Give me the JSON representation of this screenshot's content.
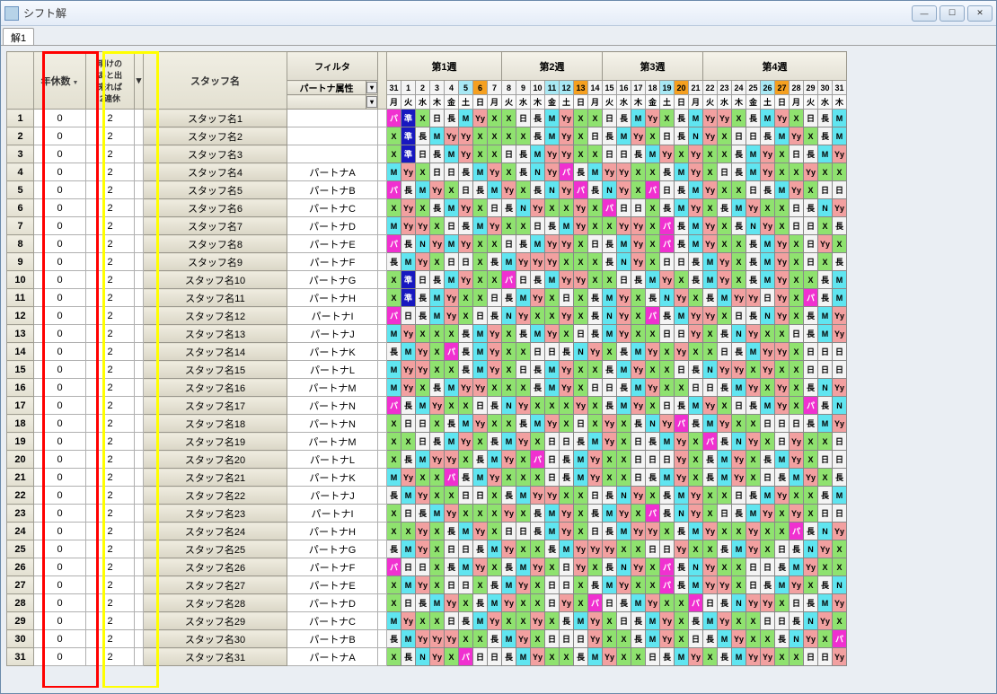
{
  "window": {
    "title": "シフト解"
  },
  "tabs": [
    "解1"
  ],
  "headers": {
    "nenkyu": "年休数",
    "ake": "明けの\nあと出\n来れば\n2連休",
    "staff": "スタッフ名",
    "filter": "フィルタ",
    "partner": "パートナ属性",
    "weeks": [
      "第1週",
      "第2週",
      "第3週",
      "第4週"
    ]
  },
  "days": [
    {
      "n": 31,
      "dow": "月",
      "cls": ""
    },
    {
      "n": 1,
      "dow": "火",
      "cls": ""
    },
    {
      "n": 2,
      "dow": "水",
      "cls": ""
    },
    {
      "n": 3,
      "dow": "木",
      "cls": ""
    },
    {
      "n": 4,
      "dow": "金",
      "cls": ""
    },
    {
      "n": 5,
      "dow": "土",
      "cls": "cy"
    },
    {
      "n": 6,
      "dow": "日",
      "cls": "or"
    },
    {
      "n": 7,
      "dow": "月",
      "cls": ""
    },
    {
      "n": 8,
      "dow": "火",
      "cls": ""
    },
    {
      "n": 9,
      "dow": "水",
      "cls": ""
    },
    {
      "n": 10,
      "dow": "木",
      "cls": ""
    },
    {
      "n": 11,
      "dow": "金",
      "cls": "cy"
    },
    {
      "n": 12,
      "dow": "土",
      "cls": "cy"
    },
    {
      "n": 13,
      "dow": "日",
      "cls": "or"
    },
    {
      "n": 14,
      "dow": "月",
      "cls": ""
    },
    {
      "n": 15,
      "dow": "火",
      "cls": ""
    },
    {
      "n": 16,
      "dow": "水",
      "cls": ""
    },
    {
      "n": 17,
      "dow": "木",
      "cls": ""
    },
    {
      "n": 18,
      "dow": "金",
      "cls": ""
    },
    {
      "n": 19,
      "dow": "土",
      "cls": "cy"
    },
    {
      "n": 20,
      "dow": "日",
      "cls": "or"
    },
    {
      "n": 21,
      "dow": "月",
      "cls": ""
    },
    {
      "n": 22,
      "dow": "火",
      "cls": ""
    },
    {
      "n": 23,
      "dow": "水",
      "cls": ""
    },
    {
      "n": 24,
      "dow": "木",
      "cls": ""
    },
    {
      "n": 25,
      "dow": "金",
      "cls": ""
    },
    {
      "n": 26,
      "dow": "土",
      "cls": "cy"
    },
    {
      "n": 27,
      "dow": "日",
      "cls": "or"
    },
    {
      "n": 28,
      "dow": "月",
      "cls": ""
    },
    {
      "n": 29,
      "dow": "火",
      "cls": ""
    },
    {
      "n": 30,
      "dow": "水",
      "cls": ""
    },
    {
      "n": 31,
      "dow": "木",
      "cls": ""
    }
  ],
  "shift_legend": {
    "パ": "c-mg",
    "X": "c-lg",
    "日": "c-wt",
    "長": "c-wt",
    "M": "c-cy",
    "Yy": "c-ry",
    "準": "c-db",
    "N": "c-cy"
  },
  "rows": [
    {
      "i": 1,
      "n": 0,
      "a": 2,
      "staff": "スタッフ名1",
      "p": "",
      "d": [
        "パ",
        "準",
        "X",
        "日",
        "長",
        "M",
        "Yy",
        "X",
        "X",
        "日",
        "長",
        "M",
        "Yy",
        "X",
        "X",
        "日",
        "長",
        "M",
        "Yy",
        "X",
        "長",
        "M",
        "Yy",
        "Yy",
        "X",
        "長",
        "M",
        "Yy",
        "X",
        "日",
        "長",
        "M"
      ]
    },
    {
      "i": 2,
      "n": 0,
      "a": 2,
      "staff": "スタッフ名2",
      "p": "",
      "d": [
        "X",
        "準",
        "長",
        "M",
        "Yy",
        "Yy",
        "X",
        "X",
        "X",
        "X",
        "長",
        "M",
        "Yy",
        "X",
        "日",
        "長",
        "M",
        "Yy",
        "X",
        "日",
        "長",
        "N",
        "Yy",
        "X",
        "日",
        "日",
        "長",
        "M",
        "Yy",
        "X",
        "長",
        "M"
      ]
    },
    {
      "i": 3,
      "n": 0,
      "a": 2,
      "staff": "スタッフ名3",
      "p": "",
      "d": [
        "X",
        "準",
        "日",
        "長",
        "M",
        "Yy",
        "X",
        "X",
        "日",
        "長",
        "M",
        "Yy",
        "Yy",
        "X",
        "X",
        "日",
        "日",
        "長",
        "M",
        "Yy",
        "X",
        "Yy",
        "X",
        "X",
        "長",
        "M",
        "Yy",
        "X",
        "日",
        "長",
        "M",
        "Yy"
      ]
    },
    {
      "i": 4,
      "n": 0,
      "a": 2,
      "staff": "スタッフ名4",
      "p": "パートナA",
      "d": [
        "M",
        "Yy",
        "X",
        "日",
        "日",
        "長",
        "M",
        "Yy",
        "X",
        "長",
        "N",
        "Yy",
        "パ",
        "長",
        "M",
        "Yy",
        "Yy",
        "X",
        "X",
        "長",
        "M",
        "Yy",
        "X",
        "日",
        "長",
        "M",
        "Yy",
        "X",
        "X",
        "Yy",
        "X",
        "X"
      ]
    },
    {
      "i": 5,
      "n": 0,
      "a": 2,
      "staff": "スタッフ名5",
      "p": "パートナB",
      "d": [
        "パ",
        "長",
        "M",
        "Yy",
        "X",
        "日",
        "長",
        "M",
        "Yy",
        "X",
        "長",
        "N",
        "Yy",
        "パ",
        "長",
        "N",
        "Yy",
        "X",
        "パ",
        "日",
        "長",
        "M",
        "Yy",
        "X",
        "X",
        "日",
        "長",
        "M",
        "Yy",
        "X",
        "日",
        "日"
      ]
    },
    {
      "i": 6,
      "n": 0,
      "a": 2,
      "staff": "スタッフ名6",
      "p": "パートナC",
      "d": [
        "X",
        "Yy",
        "X",
        "長",
        "M",
        "Yy",
        "X",
        "日",
        "長",
        "N",
        "Yy",
        "X",
        "X",
        "Yy",
        "X",
        "パ",
        "日",
        "日",
        "X",
        "長",
        "M",
        "Yy",
        "X",
        "長",
        "M",
        "Yy",
        "X",
        "X",
        "日",
        "長",
        "N",
        "Yy"
      ]
    },
    {
      "i": 7,
      "n": 0,
      "a": 2,
      "staff": "スタッフ名7",
      "p": "パートナD",
      "d": [
        "M",
        "Yy",
        "Yy",
        "X",
        "日",
        "長",
        "M",
        "Yy",
        "X",
        "X",
        "日",
        "長",
        "M",
        "Yy",
        "X",
        "X",
        "Yy",
        "Yy",
        "X",
        "パ",
        "長",
        "M",
        "Yy",
        "X",
        "長",
        "N",
        "Yy",
        "X",
        "日",
        "日",
        "X",
        "長"
      ]
    },
    {
      "i": 8,
      "n": 0,
      "a": 2,
      "staff": "スタッフ名8",
      "p": "パートナE",
      "d": [
        "パ",
        "長",
        "N",
        "Yy",
        "M",
        "Yy",
        "X",
        "X",
        "日",
        "長",
        "M",
        "Yy",
        "Yy",
        "X",
        "日",
        "長",
        "M",
        "Yy",
        "X",
        "パ",
        "長",
        "M",
        "Yy",
        "X",
        "X",
        "長",
        "M",
        "Yy",
        "X",
        "日",
        "Yy",
        "X"
      ]
    },
    {
      "i": 9,
      "n": 0,
      "a": 2,
      "staff": "スタッフ名9",
      "p": "パートナF",
      "d": [
        "長",
        "M",
        "Yy",
        "X",
        "日",
        "日",
        "X",
        "長",
        "M",
        "Yy",
        "Yy",
        "Yy",
        "X",
        "X",
        "X",
        "長",
        "N",
        "Yy",
        "X",
        "日",
        "日",
        "長",
        "M",
        "Yy",
        "X",
        "長",
        "M",
        "Yy",
        "X",
        "日",
        "X",
        "長"
      ]
    },
    {
      "i": 10,
      "n": 0,
      "a": 2,
      "staff": "スタッフ名10",
      "p": "パートナG",
      "d": [
        "X",
        "準",
        "日",
        "長",
        "M",
        "Yy",
        "X",
        "X",
        "パ",
        "日",
        "長",
        "M",
        "Yy",
        "Yy",
        "X",
        "X",
        "日",
        "長",
        "M",
        "Yy",
        "X",
        "長",
        "M",
        "Yy",
        "X",
        "長",
        "M",
        "Yy",
        "X",
        "X",
        "長",
        "M"
      ]
    },
    {
      "i": 11,
      "n": 0,
      "a": 2,
      "staff": "スタッフ名11",
      "p": "パートナH",
      "d": [
        "X",
        "準",
        "長",
        "M",
        "Yy",
        "X",
        "X",
        "日",
        "長",
        "M",
        "Yy",
        "X",
        "日",
        "X",
        "長",
        "M",
        "Yy",
        "X",
        "長",
        "N",
        "Yy",
        "X",
        "長",
        "M",
        "Yy",
        "Yy",
        "日",
        "Yy",
        "X",
        "パ",
        "長",
        "M"
      ]
    },
    {
      "i": 12,
      "n": 0,
      "a": 2,
      "staff": "スタッフ名12",
      "p": "パートナI",
      "d": [
        "パ",
        "日",
        "長",
        "M",
        "Yy",
        "X",
        "日",
        "長",
        "N",
        "Yy",
        "X",
        "X",
        "Yy",
        "X",
        "長",
        "N",
        "Yy",
        "X",
        "パ",
        "長",
        "M",
        "Yy",
        "Yy",
        "X",
        "日",
        "長",
        "N",
        "Yy",
        "X",
        "長",
        "M",
        "Yy"
      ]
    },
    {
      "i": 13,
      "n": 0,
      "a": 2,
      "staff": "スタッフ名13",
      "p": "パートナJ",
      "d": [
        "M",
        "Yy",
        "X",
        "X",
        "X",
        "長",
        "M",
        "Yy",
        "X",
        "長",
        "M",
        "Yy",
        "X",
        "日",
        "長",
        "M",
        "Yy",
        "X",
        "X",
        "日",
        "日",
        "Yy",
        "X",
        "長",
        "N",
        "Yy",
        "X",
        "X",
        "日",
        "長",
        "M",
        "Yy"
      ]
    },
    {
      "i": 14,
      "n": 0,
      "a": 2,
      "staff": "スタッフ名14",
      "p": "パートナK",
      "d": [
        "長",
        "M",
        "Yy",
        "X",
        "パ",
        "長",
        "M",
        "Yy",
        "X",
        "X",
        "日",
        "日",
        "長",
        "N",
        "Yy",
        "X",
        "長",
        "M",
        "Yy",
        "X",
        "Yy",
        "X",
        "X",
        "日",
        "長",
        "M",
        "Yy",
        "Yy",
        "X",
        "日",
        "日",
        "日"
      ]
    },
    {
      "i": 15,
      "n": 0,
      "a": 2,
      "staff": "スタッフ名15",
      "p": "パートナL",
      "d": [
        "M",
        "Yy",
        "Yy",
        "X",
        "X",
        "長",
        "M",
        "Yy",
        "X",
        "日",
        "長",
        "M",
        "Yy",
        "X",
        "X",
        "長",
        "M",
        "Yy",
        "X",
        "X",
        "日",
        "長",
        "N",
        "Yy",
        "Yy",
        "X",
        "Yy",
        "X",
        "X",
        "日",
        "日",
        "日"
      ]
    },
    {
      "i": 16,
      "n": 0,
      "a": 2,
      "staff": "スタッフ名16",
      "p": "パートナM",
      "d": [
        "M",
        "Yy",
        "X",
        "長",
        "M",
        "Yy",
        "Yy",
        "X",
        "X",
        "X",
        "長",
        "M",
        "Yy",
        "X",
        "日",
        "日",
        "長",
        "M",
        "Yy",
        "X",
        "X",
        "日",
        "日",
        "長",
        "M",
        "Yy",
        "X",
        "Yy",
        "X",
        "長",
        "N",
        "Yy"
      ]
    },
    {
      "i": 17,
      "n": 0,
      "a": 2,
      "staff": "スタッフ名17",
      "p": "パートナN",
      "d": [
        "パ",
        "長",
        "M",
        "Yy",
        "X",
        "X",
        "日",
        "長",
        "N",
        "Yy",
        "X",
        "X",
        "X",
        "Yy",
        "X",
        "長",
        "M",
        "Yy",
        "X",
        "日",
        "長",
        "M",
        "Yy",
        "X",
        "日",
        "長",
        "M",
        "Yy",
        "X",
        "パ",
        "長",
        "N"
      ]
    },
    {
      "i": 18,
      "n": 0,
      "a": 2,
      "staff": "スタッフ名18",
      "p": "パートナN",
      "d": [
        "X",
        "日",
        "日",
        "X",
        "長",
        "M",
        "Yy",
        "X",
        "X",
        "長",
        "M",
        "Yy",
        "X",
        "日",
        "X",
        "Yy",
        "X",
        "長",
        "N",
        "Yy",
        "パ",
        "長",
        "M",
        "Yy",
        "X",
        "X",
        "日",
        "日",
        "日",
        "長",
        "M",
        "Yy"
      ]
    },
    {
      "i": 19,
      "n": 0,
      "a": 2,
      "staff": "スタッフ名19",
      "p": "パートナM",
      "d": [
        "X",
        "X",
        "日",
        "長",
        "M",
        "Yy",
        "X",
        "長",
        "M",
        "Yy",
        "X",
        "日",
        "日",
        "長",
        "M",
        "Yy",
        "X",
        "日",
        "長",
        "M",
        "Yy",
        "X",
        "パ",
        "長",
        "N",
        "Yy",
        "X",
        "日",
        "Yy",
        "X",
        "X",
        "日"
      ]
    },
    {
      "i": 20,
      "n": 0,
      "a": 2,
      "staff": "スタッフ名20",
      "p": "パートナL",
      "d": [
        "X",
        "長",
        "M",
        "Yy",
        "Yy",
        "X",
        "長",
        "M",
        "Yy",
        "X",
        "パ",
        "日",
        "長",
        "M",
        "Yy",
        "X",
        "X",
        "日",
        "日",
        "日",
        "Yy",
        "X",
        "長",
        "M",
        "Yy",
        "X",
        "長",
        "M",
        "Yy",
        "X",
        "日",
        "日"
      ]
    },
    {
      "i": 21,
      "n": 0,
      "a": 2,
      "staff": "スタッフ名21",
      "p": "パートナK",
      "d": [
        "M",
        "Yy",
        "X",
        "X",
        "パ",
        "長",
        "M",
        "Yy",
        "X",
        "X",
        "X",
        "日",
        "長",
        "M",
        "Yy",
        "X",
        "X",
        "日",
        "長",
        "M",
        "Yy",
        "X",
        "長",
        "M",
        "Yy",
        "X",
        "日",
        "長",
        "M",
        "Yy",
        "X",
        "長"
      ]
    },
    {
      "i": 22,
      "n": 0,
      "a": 2,
      "staff": "スタッフ名22",
      "p": "パートナJ",
      "d": [
        "長",
        "M",
        "Yy",
        "X",
        "X",
        "日",
        "日",
        "X",
        "長",
        "M",
        "Yy",
        "Yy",
        "X",
        "X",
        "日",
        "長",
        "N",
        "Yy",
        "X",
        "長",
        "M",
        "Yy",
        "X",
        "X",
        "日",
        "長",
        "M",
        "Yy",
        "X",
        "X",
        "長",
        "M"
      ]
    },
    {
      "i": 23,
      "n": 0,
      "a": 2,
      "staff": "スタッフ名23",
      "p": "パートナI",
      "d": [
        "X",
        "日",
        "長",
        "M",
        "Yy",
        "X",
        "X",
        "X",
        "Yy",
        "X",
        "長",
        "M",
        "Yy",
        "X",
        "長",
        "M",
        "Yy",
        "X",
        "パ",
        "長",
        "N",
        "Yy",
        "X",
        "日",
        "長",
        "M",
        "Yy",
        "X",
        "Yy",
        "X",
        "日",
        "日"
      ]
    },
    {
      "i": 24,
      "n": 0,
      "a": 2,
      "staff": "スタッフ名24",
      "p": "パートナH",
      "d": [
        "X",
        "X",
        "Yy",
        "X",
        "長",
        "M",
        "Yy",
        "X",
        "日",
        "日",
        "長",
        "M",
        "Yy",
        "X",
        "日",
        "長",
        "M",
        "Yy",
        "Yy",
        "X",
        "長",
        "M",
        "Yy",
        "X",
        "X",
        "Yy",
        "X",
        "X",
        "パ",
        "長",
        "N",
        "Yy"
      ]
    },
    {
      "i": 25,
      "n": 0,
      "a": 2,
      "staff": "スタッフ名25",
      "p": "パートナG",
      "d": [
        "長",
        "M",
        "Yy",
        "X",
        "日",
        "日",
        "長",
        "M",
        "Yy",
        "X",
        "X",
        "長",
        "M",
        "Yy",
        "Yy",
        "Yy",
        "X",
        "X",
        "日",
        "日",
        "Yy",
        "X",
        "X",
        "長",
        "M",
        "Yy",
        "X",
        "日",
        "長",
        "N",
        "Yy",
        "X"
      ]
    },
    {
      "i": 26,
      "n": 0,
      "a": 2,
      "staff": "スタッフ名26",
      "p": "パートナF",
      "d": [
        "パ",
        "日",
        "日",
        "X",
        "長",
        "M",
        "Yy",
        "X",
        "長",
        "M",
        "Yy",
        "X",
        "日",
        "Yy",
        "X",
        "長",
        "N",
        "Yy",
        "X",
        "パ",
        "長",
        "N",
        "Yy",
        "X",
        "X",
        "日",
        "日",
        "長",
        "M",
        "Yy",
        "X",
        "X"
      ]
    },
    {
      "i": 27,
      "n": 0,
      "a": 2,
      "staff": "スタッフ名27",
      "p": "パートナE",
      "d": [
        "X",
        "M",
        "Yy",
        "X",
        "日",
        "日",
        "X",
        "長",
        "M",
        "Yy",
        "X",
        "日",
        "日",
        "X",
        "長",
        "M",
        "Yy",
        "X",
        "X",
        "パ",
        "長",
        "M",
        "Yy",
        "Yy",
        "X",
        "日",
        "長",
        "M",
        "Yy",
        "X",
        "長",
        "N"
      ]
    },
    {
      "i": 28,
      "n": 0,
      "a": 2,
      "staff": "スタッフ名28",
      "p": "パートナD",
      "d": [
        "X",
        "日",
        "長",
        "M",
        "Yy",
        "X",
        "長",
        "M",
        "Yy",
        "X",
        "X",
        "日",
        "Yy",
        "X",
        "パ",
        "日",
        "長",
        "M",
        "Yy",
        "X",
        "X",
        "パ",
        "日",
        "長",
        "N",
        "Yy",
        "Yy",
        "X",
        "日",
        "長",
        "M",
        "Yy"
      ]
    },
    {
      "i": 29,
      "n": 0,
      "a": 2,
      "staff": "スタッフ名29",
      "p": "パートナC",
      "d": [
        "M",
        "Yy",
        "X",
        "X",
        "日",
        "長",
        "M",
        "Yy",
        "X",
        "X",
        "Yy",
        "X",
        "長",
        "M",
        "Yy",
        "X",
        "日",
        "長",
        "M",
        "Yy",
        "X",
        "長",
        "M",
        "Yy",
        "X",
        "X",
        "日",
        "日",
        "長",
        "N",
        "Yy",
        "X"
      ]
    },
    {
      "i": 30,
      "n": 0,
      "a": 2,
      "staff": "スタッフ名30",
      "p": "パートナB",
      "d": [
        "長",
        "M",
        "Yy",
        "Yy",
        "Yy",
        "X",
        "X",
        "長",
        "M",
        "Yy",
        "X",
        "日",
        "日",
        "日",
        "Yy",
        "X",
        "X",
        "長",
        "M",
        "Yy",
        "X",
        "日",
        "長",
        "M",
        "Yy",
        "X",
        "X",
        "長",
        "N",
        "Yy",
        "X",
        "パ"
      ]
    },
    {
      "i": 31,
      "n": 0,
      "a": 2,
      "staff": "スタッフ名31",
      "p": "パートナA",
      "d": [
        "X",
        "長",
        "N",
        "Yy",
        "X",
        "パ",
        "日",
        "日",
        "長",
        "M",
        "Yy",
        "X",
        "X",
        "長",
        "M",
        "Yy",
        "X",
        "X",
        "日",
        "長",
        "M",
        "Yy",
        "X",
        "長",
        "M",
        "Yy",
        "Yy",
        "X",
        "X",
        "日",
        "日",
        "Yy"
      ]
    }
  ]
}
